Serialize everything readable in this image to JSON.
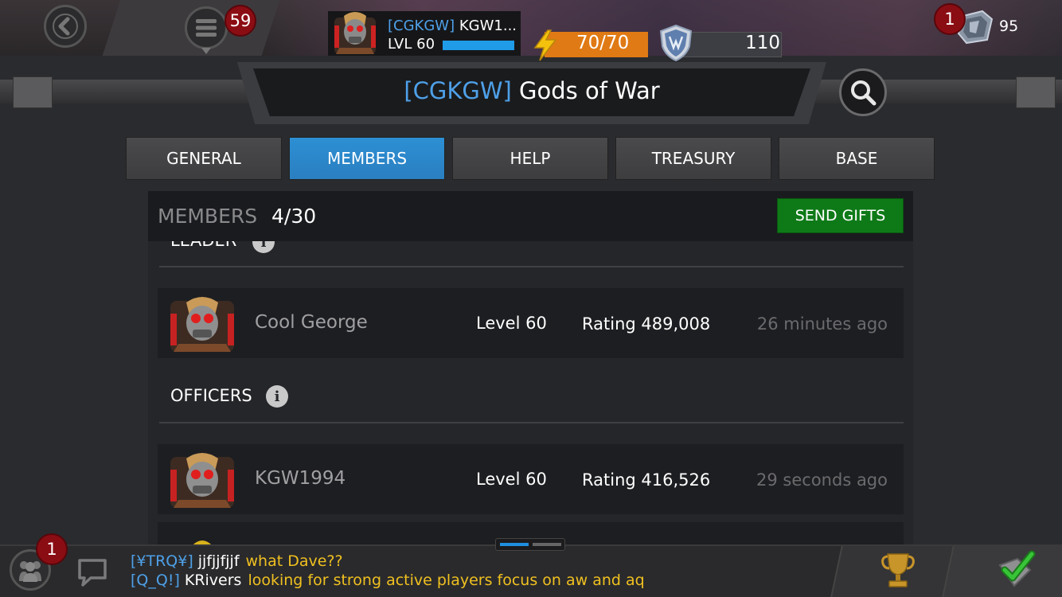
{
  "topbar": {
    "menu_badge": "59",
    "profile": {
      "tag": "[CGKGW]",
      "name": "KGW1...",
      "level": "LVL 60"
    },
    "energy": "70/70",
    "arena_rating": "110",
    "units_badge": "1",
    "units": "95"
  },
  "alliance": {
    "tag": "[CGKGW]",
    "name": "Gods of War"
  },
  "tabs": [
    {
      "label": "GENERAL"
    },
    {
      "label": "MEMBERS",
      "active": true
    },
    {
      "label": "HELP"
    },
    {
      "label": "TREASURY"
    },
    {
      "label": "BASE"
    }
  ],
  "panel": {
    "members_label": "MEMBERS",
    "members_count": "4/30",
    "send_gifts_label": "SEND GIFTS",
    "leader_section": "LEADER",
    "officers_section": "OFFICERS",
    "leaders": [
      {
        "name": "Cool George",
        "level": "Level 60",
        "rating": "Rating 489,008",
        "last_seen": "26 minutes ago"
      }
    ],
    "officers": [
      {
        "name": "KGW1994",
        "level": "Level 60",
        "rating": "Rating 416,526",
        "last_seen": "29 seconds ago"
      }
    ]
  },
  "chat": {
    "alliance_badge": "1",
    "messages": [
      {
        "tag": "[¥TRQ¥]",
        "name": "jjfjjfjjf",
        "text": "what Dave??"
      },
      {
        "tag": "[Q_Q!]",
        "name": "KRivers",
        "text": "looking for strong active players focus on aw and aq"
      }
    ]
  },
  "colors": {
    "accent_blue": "#2d8fd4",
    "tag_blue": "#4ea0e8",
    "gift_green": "#0e7a17",
    "badge_red": "#8b0d14",
    "chat_yellow": "#f0c020",
    "energy_orange": "#e07a14"
  },
  "icons": [
    "back-arrow-icon",
    "menu-icon",
    "hero-avatar-icon",
    "lightning-bolt-icon",
    "arena-shield-icon",
    "units-crystal-icon",
    "search-icon",
    "info-icon",
    "alliance-icon",
    "chat-bubble-icon",
    "trophy-icon",
    "checkmark-icon"
  ]
}
